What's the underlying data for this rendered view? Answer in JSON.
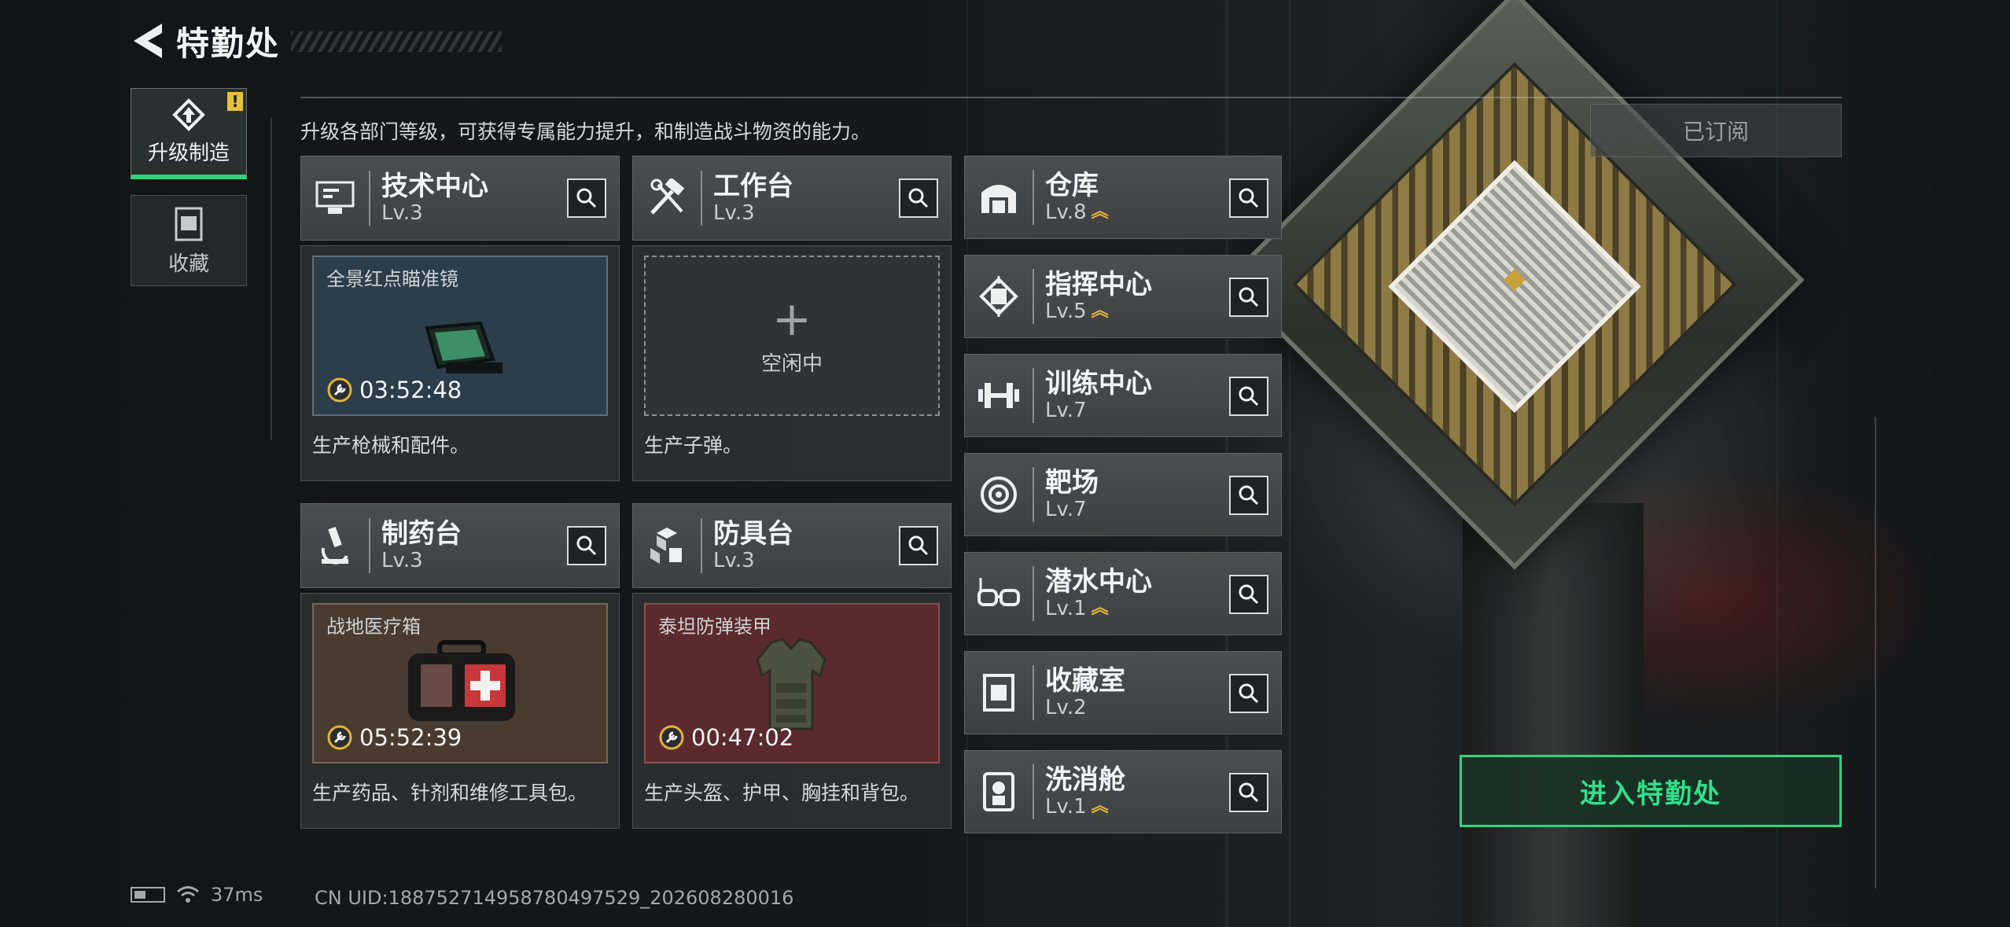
{
  "header": {
    "title": "特勤处"
  },
  "sidebar": {
    "tabs": [
      {
        "label": "升级制造",
        "badge": "!"
      },
      {
        "label": "收藏"
      }
    ]
  },
  "description": "升级各部门等级，可获得专属能力提升，和制造战斗物资的能力。",
  "subscribed_label": "已订阅",
  "left_departments": [
    {
      "name": "技术中心",
      "level": "Lv.3",
      "slot_title": "全景红点瞄准镜",
      "timer": "03:52:48",
      "desc": "生产枪械和配件。"
    },
    {
      "name": "工作台",
      "level": "Lv.3",
      "slot_title": "",
      "idle_text": "空闲中",
      "desc": "生产子弹。"
    },
    {
      "name": "制药台",
      "level": "Lv.3",
      "slot_title": "战地医疗箱",
      "timer": "05:52:39",
      "desc": "生产药品、针剂和维修工具包。"
    },
    {
      "name": "防具台",
      "level": "Lv.3",
      "slot_title": "泰坦防弹装甲",
      "timer": "00:47:02",
      "desc": "生产头盔、护甲、胸挂和背包。"
    }
  ],
  "right_departments": [
    {
      "name": "仓库",
      "level": "Lv.8",
      "upgradable": true
    },
    {
      "name": "指挥中心",
      "level": "Lv.5",
      "upgradable": true
    },
    {
      "name": "训练中心",
      "level": "Lv.7",
      "upgradable": false
    },
    {
      "name": "靶场",
      "level": "Lv.7",
      "upgradable": false
    },
    {
      "name": "潜水中心",
      "level": "Lv.1",
      "upgradable": true
    },
    {
      "name": "收藏室",
      "level": "Lv.2",
      "upgradable": false
    },
    {
      "name": "洗消舱",
      "level": "Lv.1",
      "upgradable": true
    }
  ],
  "upgrade_chevron": "︽",
  "enter_button": "进入特勤处",
  "status": {
    "ping": "37ms",
    "uid": "CN UID:188752714958780497529_202608280016"
  },
  "colors": {
    "accent_green": "#2fd47e",
    "upgrade_gold": "#e3b23c",
    "slot_blue": "#2c3d4c",
    "slot_brown": "#4a3b30",
    "slot_red": "#5a2a2c"
  }
}
